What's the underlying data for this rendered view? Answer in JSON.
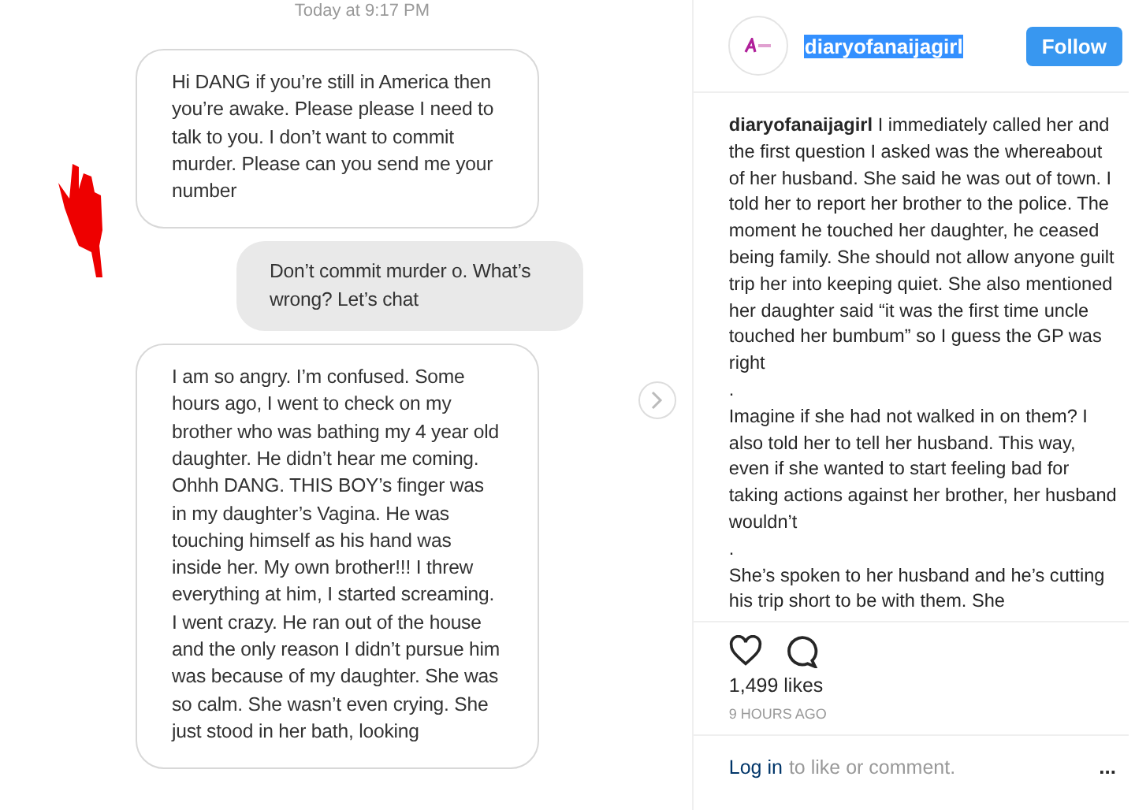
{
  "chat_image": {
    "timestamp": "Today at 9:17 PM",
    "messages": [
      {
        "text": "Hi DANG if you’re still in America then you’re awake. Please please I need to talk to you. I don’t want to commit murder. Please can you send me your number",
        "kind": "incoming"
      },
      {
        "text": "Don’t commit murder o. What’s wrong? Let’s chat",
        "kind": "outgoing"
      },
      {
        "text": "I am so angry. I’m confused. Some hours ago, I went to check on my brother who was bathing my 4 year old daughter. He didn’t hear me coming. Ohhh DANG. THIS BOY’s finger was in my daughter’s Vagina. He was  touching himself as his hand was inside her. My own brother!!! I threw everything at him, I started screaming. I went crazy. He ran out of the house and the only reason I didn’t pursue him was because of my daughter. She was so calm. She wasn’t even crying. She just stood in her bath, looking",
        "kind": "incoming"
      }
    ]
  },
  "post": {
    "username": "diaryofanaijagirl",
    "username_selected": true,
    "follow_button": "Follow",
    "caption": {
      "author": "diaryofanaijagirl",
      "paragraphs": [
        "I immediately called her and the first question I asked was the whereabout of her husband. She said he was out of town. I told her to report her brother to the police. The moment he touched her daughter, he ceased being family. She should not allow anyone guilt trip her into keeping quiet. She also mentioned her daughter said “it was the first time uncle touched her bumbum” so I guess the GP was right",
        ".",
        "Imagine if she had not walked in on them? I also told her to tell her husband. This way, even if she wanted to start feeling bad for taking actions against her brother, her husband wouldn’t",
        ".",
        "She’s spoken to her husband and he’s cutting his trip short to be with them. She"
      ]
    },
    "likes": "1,499 likes",
    "time": "9 HOURS AGO",
    "login_link": "Log in",
    "login_text": "to like or comment.",
    "more": "..."
  }
}
